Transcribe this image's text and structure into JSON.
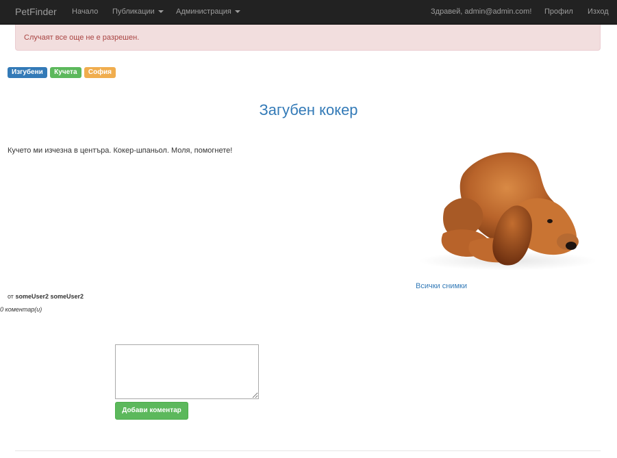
{
  "navbar": {
    "brand": "PetFinder",
    "items": [
      {
        "label": "Начало"
      },
      {
        "label": "Публикации"
      },
      {
        "label": "Администрация"
      }
    ],
    "greeting": "Здравей, admin@admin.com!",
    "profile": "Профил",
    "logout": "Изход"
  },
  "alert": {
    "text": "Случаят все още не е разрешен."
  },
  "tags": [
    {
      "label": "Изгубени",
      "color": "#337ab7"
    },
    {
      "label": "Кучета",
      "color": "#5cb85c"
    },
    {
      "label": "София",
      "color": "#f0ad4e"
    }
  ],
  "post": {
    "title": "Загубен кокер",
    "description": "Кучето ми изчезна в центъра. Кокер-шпаньол. Моля, помогнете!",
    "all_photos": "Всички снимки",
    "author_prefix": "от",
    "author_name": "someUser2 someUser2",
    "comment_count": "0 коментар(и)"
  },
  "comment_form": {
    "placeholder": "",
    "submit_label": "Добави коментар"
  },
  "colors": {
    "navbar_bg": "#222222",
    "link": "#337ab7",
    "alert_bg": "#f2dede",
    "alert_text": "#a94442",
    "success": "#5cb85c"
  }
}
